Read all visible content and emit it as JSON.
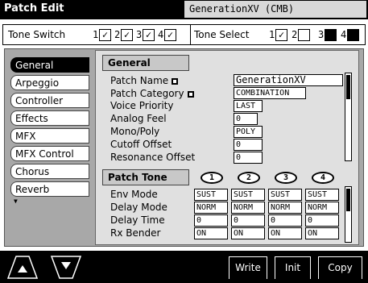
{
  "title_bar": {
    "title": "Patch Edit",
    "patch_name": "GenerationXV (CMB)"
  },
  "tone_switch": {
    "label": "Tone Switch",
    "tones": [
      {
        "num": "1",
        "mark": "✓"
      },
      {
        "num": "2",
        "mark": "✓"
      },
      {
        "num": "3",
        "mark": "✓"
      },
      {
        "num": "4",
        "mark": "✓"
      }
    ]
  },
  "tone_select": {
    "label": "Tone Select",
    "tones": [
      {
        "num": "1",
        "mark": "✓"
      },
      {
        "num": "2",
        "mark": ""
      },
      {
        "num": "3",
        "mark": ""
      },
      {
        "num": "4",
        "mark": ""
      }
    ]
  },
  "categories": [
    "General",
    "Arpeggio",
    "Controller",
    "Effects",
    "MFX",
    "MFX Control",
    "Chorus",
    "Reverb"
  ],
  "category_scroll_icon": "▼",
  "general": {
    "heading": "General",
    "params": [
      {
        "label": "Patch Name",
        "value": "GenerationXV",
        "has_edit_icon": true
      },
      {
        "label": "Patch Category",
        "value": "COMBINATION",
        "has_edit_icon": true
      },
      {
        "label": "Voice Priority",
        "value": "LAST"
      },
      {
        "label": "Analog Feel",
        "value": "0"
      },
      {
        "label": "Mono/Poly",
        "value": "POLY"
      },
      {
        "label": "Cutoff Offset",
        "value": "0"
      },
      {
        "label": "Resonance Offset",
        "value": "0"
      }
    ]
  },
  "patch_tone": {
    "heading": "Patch Tone",
    "tone_numbers": [
      "1",
      "2",
      "3",
      "4"
    ],
    "rows": [
      {
        "label": "Env Mode",
        "values": [
          "SUST",
          "SUST",
          "SUST",
          "SUST"
        ]
      },
      {
        "label": "Delay Mode",
        "values": [
          "NORM",
          "NORM",
          "NORM",
          "NORM"
        ]
      },
      {
        "label": "Delay Time",
        "values": [
          "0",
          "0",
          "0",
          "0"
        ]
      },
      {
        "label": "Rx Bender",
        "values": [
          "ON",
          "ON",
          "ON",
          "ON"
        ]
      }
    ]
  },
  "function_buttons": {
    "write": "Write",
    "init": "Init",
    "copy": "Copy"
  },
  "nav": {
    "up_icon": "up-arrow-icon",
    "down_icon": "down-arrow-icon"
  }
}
